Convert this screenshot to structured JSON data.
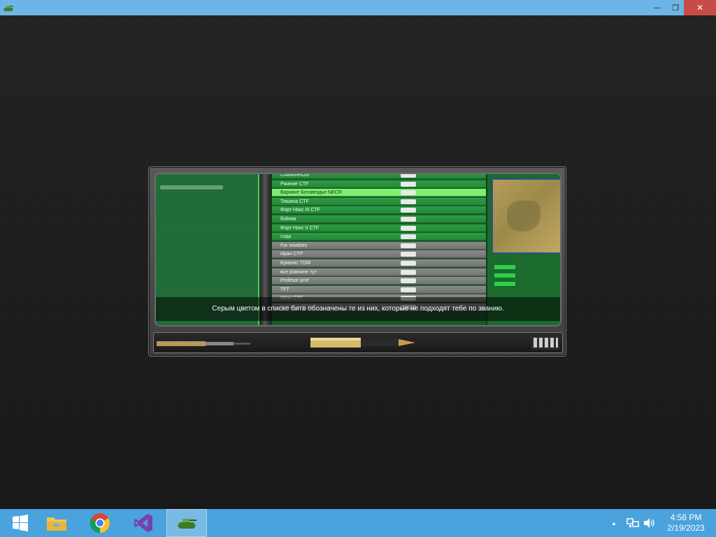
{
  "window": {
    "close_glyph": "✕",
    "min_glyph": "—",
    "restore_glyph": "❐"
  },
  "tutorial": {
    "caption": "Серым цветом в списке битв обозначены те из них, которые не подходят тебе по званию.",
    "battles": [
      {
        "name": "САБМЯНОМ",
        "state": "green"
      },
      {
        "name": "Ржание CTF",
        "state": "green"
      },
      {
        "name": "Вариант Беззвездье NECR",
        "state": "sel"
      },
      {
        "name": "Тишина CTF",
        "state": "green"
      },
      {
        "name": "Форт Нокс III CTF",
        "state": "green"
      },
      {
        "name": "бойняк",
        "state": "green"
      },
      {
        "name": "Форт Нокс II CTF",
        "state": "green"
      },
      {
        "name": "сода",
        "state": "green"
      },
      {
        "name": "For nowbies",
        "state": "gray"
      },
      {
        "name": "Иран CTF",
        "state": "gray"
      },
      {
        "name": "Буквонс TDM",
        "state": "gray"
      },
      {
        "name": "все ровнине тут",
        "state": "gray"
      },
      {
        "name": "Profesor prof",
        "state": "gray"
      },
      {
        "name": "TFT",
        "state": "gray"
      },
      {
        "name": "Иран CTF",
        "state": "gray"
      },
      {
        "name": "ревгость TDM",
        "state": "gray"
      }
    ]
  },
  "taskbar": {
    "apps": [
      "start",
      "file-explorer",
      "chrome",
      "visual-studio",
      "tanki-game"
    ],
    "clock_time": "4:56 PM",
    "clock_date": "2/19/2023",
    "tray_arrow": "▲"
  },
  "colors": {
    "titlebar": "#6fb4e6",
    "close": "#c74b46",
    "taskbar": "#4aa3dc",
    "green_row": "#228a37",
    "selected_row": "#7ef06f",
    "gray_row": "#7f7f7f"
  }
}
